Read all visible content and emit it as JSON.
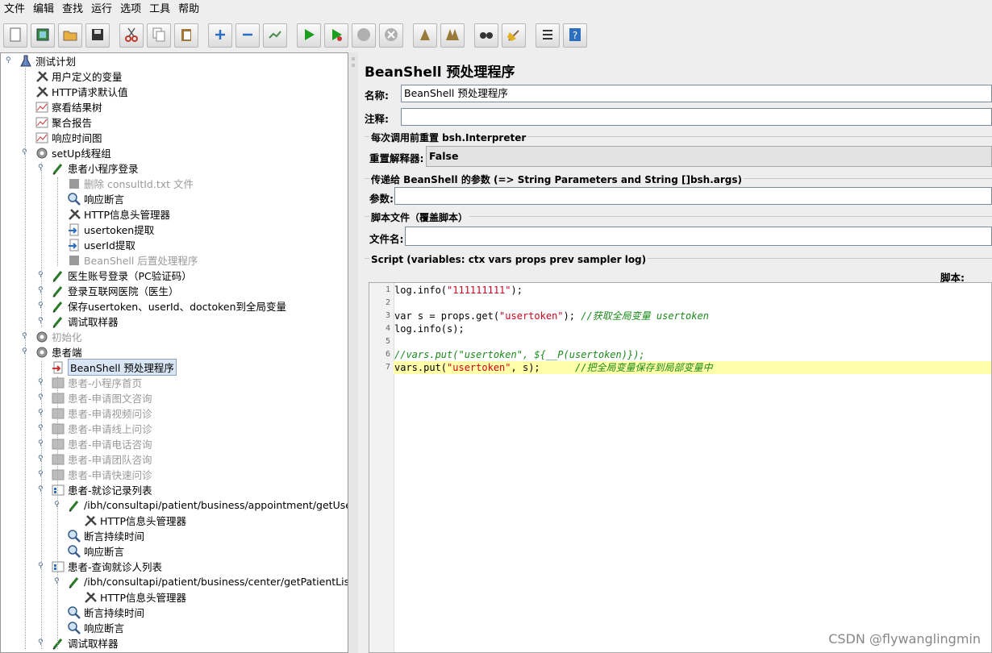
{
  "menu": [
    "文件",
    "编辑",
    "查找",
    "运行",
    "选项",
    "工具",
    "帮助"
  ],
  "toolbar": {
    "buttons": [
      {
        "name": "new-icon",
        "color": "#ffffff"
      },
      {
        "name": "templates-icon",
        "color": "#3a8f3a"
      },
      {
        "name": "open-icon",
        "color": "#e8b040"
      },
      {
        "name": "save-icon",
        "color": "#333333"
      },
      {
        "name": "cut-icon",
        "color": "#c0392b"
      },
      {
        "name": "copy-icon",
        "color": "#888888"
      },
      {
        "name": "paste-icon",
        "color": "#a0763a"
      },
      {
        "name": "expand-icon",
        "color": "#2c6fbf"
      },
      {
        "name": "collapse-icon",
        "color": "#2c6fbf"
      },
      {
        "name": "toggle-icon",
        "color": "#4a8a4a"
      },
      {
        "name": "start-icon",
        "color": "#1e9e1e"
      },
      {
        "name": "start-no-pauses-icon",
        "color": "#1e9e1e"
      },
      {
        "name": "stop-icon",
        "color": "#b0b0b0"
      },
      {
        "name": "shutdown-icon",
        "color": "#b0b0b0"
      },
      {
        "name": "clear-icon",
        "color": "#9a7a3a"
      },
      {
        "name": "clear-all-icon",
        "color": "#9a7a3a"
      },
      {
        "name": "search-icon",
        "color": "#333333"
      },
      {
        "name": "reset-search-icon",
        "color": "#e0b020"
      },
      {
        "name": "function-helper-icon",
        "color": "#333333"
      },
      {
        "name": "help-icon",
        "color": "#2c6fbf"
      }
    ]
  },
  "tree": [
    {
      "label": "测试计划",
      "icon": "flask-icon",
      "state": "normal"
    },
    {
      "label": "用户定义的变量",
      "icon": "config-icon",
      "state": "normal"
    },
    {
      "label": "HTTP请求默认值",
      "icon": "config-icon",
      "state": "normal"
    },
    {
      "label": "察看结果树",
      "icon": "listener-icon",
      "state": "normal"
    },
    {
      "label": "聚合报告",
      "icon": "listener-icon",
      "state": "normal"
    },
    {
      "label": "响应时间图",
      "icon": "listener-icon",
      "state": "normal"
    },
    {
      "label": "setUp线程组",
      "icon": "gear-icon",
      "state": "normal"
    },
    {
      "label": "患者小程序登录",
      "icon": "sampler-icon",
      "state": "normal"
    },
    {
      "label": "删除 consultId.txt 文件",
      "icon": "beanshell-icon",
      "state": "disabled"
    },
    {
      "label": "响应断言",
      "icon": "assertion-icon",
      "state": "normal"
    },
    {
      "label": "HTTP信息头管理器",
      "icon": "config-icon",
      "state": "normal"
    },
    {
      "label": "usertoken提取",
      "icon": "postprocessor-icon",
      "state": "normal"
    },
    {
      "label": "userId提取",
      "icon": "postprocessor-icon",
      "state": "normal"
    },
    {
      "label": "BeanShell 后置处理程序",
      "icon": "beanshell-icon",
      "state": "disabled"
    },
    {
      "label": "医生账号登录（PC验证码）",
      "icon": "sampler-icon",
      "state": "normal"
    },
    {
      "label": "登录互联网医院（医生）",
      "icon": "sampler-icon",
      "state": "normal"
    },
    {
      "label": "保存usertoken、userId、doctoken到全局变量",
      "icon": "sampler-icon",
      "state": "normal"
    },
    {
      "label": "调试取样器",
      "icon": "sampler-icon",
      "state": "normal"
    },
    {
      "label": "初始化",
      "icon": "gear-icon",
      "state": "disabled"
    },
    {
      "label": "患者端",
      "icon": "gear-icon",
      "state": "normal"
    },
    {
      "label": "BeanShell 预处理程序",
      "icon": "preprocessor-icon",
      "state": "selected"
    },
    {
      "label": "患者-小程序首页",
      "icon": "controller-icon",
      "state": "disabled"
    },
    {
      "label": "患者-申请图文咨询",
      "icon": "controller-icon",
      "state": "disabled"
    },
    {
      "label": "患者-申请视频问诊",
      "icon": "controller-icon",
      "state": "disabled"
    },
    {
      "label": "患者-申请线上问诊",
      "icon": "controller-icon",
      "state": "disabled"
    },
    {
      "label": "患者-申请电话咨询",
      "icon": "controller-icon",
      "state": "disabled"
    },
    {
      "label": "患者-申请团队咨询",
      "icon": "controller-icon",
      "state": "disabled"
    },
    {
      "label": "患者-申请快速问诊",
      "icon": "controller-icon",
      "state": "disabled"
    },
    {
      "label": "患者-就诊记录列表",
      "icon": "transaction-icon",
      "state": "normal"
    },
    {
      "label": "/ibh/consultapi/patient/business/appointment/getUserCons",
      "icon": "sampler-icon",
      "state": "normal"
    },
    {
      "label": "HTTP信息头管理器",
      "icon": "config-icon",
      "state": "normal"
    },
    {
      "label": "断言持续时间",
      "icon": "assertion-icon",
      "state": "normal"
    },
    {
      "label": "响应断言",
      "icon": "assertion-icon",
      "state": "normal"
    },
    {
      "label": "患者-查询就诊人列表",
      "icon": "transaction-icon",
      "state": "normal"
    },
    {
      "label": "/ibh/consultapi/patient/business/center/getPatientList",
      "icon": "sampler-icon",
      "state": "normal"
    },
    {
      "label": "HTTP信息头管理器",
      "icon": "config-icon",
      "state": "normal"
    },
    {
      "label": "断言持续时间",
      "icon": "assertion-icon",
      "state": "normal"
    },
    {
      "label": "响应断言",
      "icon": "assertion-icon",
      "state": "normal"
    },
    {
      "label": "调试取样器",
      "icon": "sampler-icon",
      "state": "normal"
    }
  ],
  "editor": {
    "title": "BeanShell 预处理程序",
    "name_label": "名称:",
    "name_value": "BeanShell 预处理程序",
    "comment_label": "注释:",
    "comment_value": "",
    "reset_group_title": "每次调用前重置 bsh.Interpreter",
    "reset_label": "重置解释器:",
    "reset_value": "False",
    "params_group_title": "传递给 BeanShell 的参数 (=> String Parameters and String []bsh.args)",
    "params_label": "参数:",
    "params_value": "",
    "file_group_title": "脚本文件（覆盖脚本）",
    "file_label": "文件名:",
    "file_value": "",
    "script_group_title": "Script (variables: ctx vars props prev sampler log)",
    "script_label": "脚本:",
    "script_lines": [
      "log.info(\"111111111\");",
      "",
      "var s = props.get(\"usertoken\"); //获取全局变量 usertoken",
      "log.info(s);",
      "",
      "//vars.put(\"usertoken\", ${__P(usertoken)});",
      "vars.put(\"usertoken\", s);      //把全局变量保存到局部变量中"
    ],
    "highlighted_line": 7
  },
  "watermark": "CSDN @flywanglingmin"
}
